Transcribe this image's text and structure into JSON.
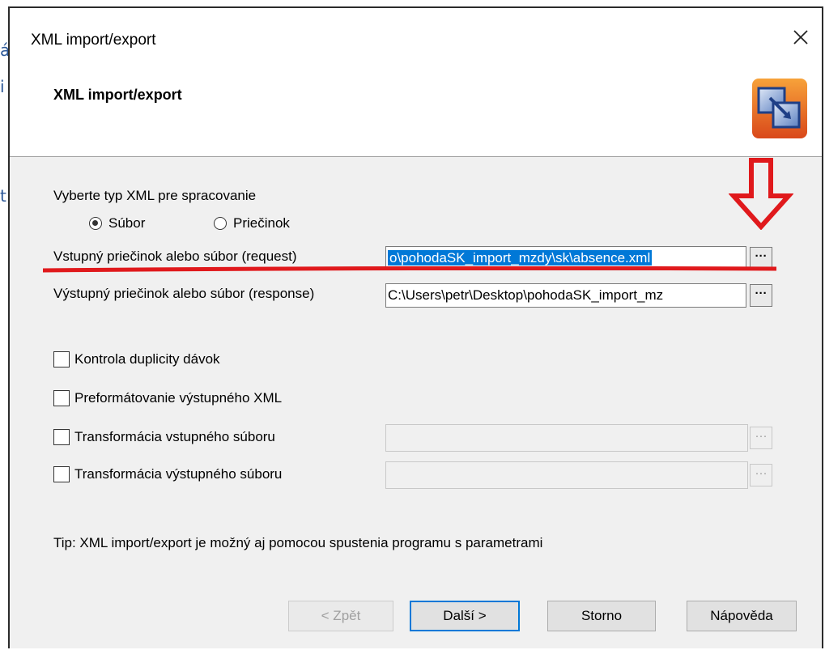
{
  "window": {
    "title": "XML import/export",
    "header_title": "XML import/export"
  },
  "form": {
    "type_prompt": "Vyberte typ XML pre spracovanie",
    "radio_file": "Súbor",
    "radio_folder": "Priečinok",
    "input_label": "Vstupný priečinok alebo súbor (request)",
    "input_value": "o\\pohodaSK_import_mzdy\\sk\\absence.xml",
    "output_label": "Výstupný priečinok alebo súbor (response)",
    "output_value": "C:\\Users\\petr\\Desktop\\pohodaSK_import_mz",
    "browse_label": "···",
    "checkboxes": [
      {
        "label": "Kontrola duplicity dávok"
      },
      {
        "label": "Preformátovanie výstupného XML"
      },
      {
        "label": "Transformácia vstupného súboru"
      },
      {
        "label": "Transformácia výstupného súboru"
      }
    ],
    "tip": "Tip: XML import/export je možný aj pomocou spustenia programu s parametrami"
  },
  "buttons": {
    "back": "< Zpět",
    "next": "Další >",
    "cancel": "Storno",
    "help": "Nápověda"
  },
  "colors": {
    "annotation": "#e0191c",
    "selection": "#0078d7"
  },
  "icons": {
    "close": "close-icon",
    "logo": "app-logo-icon",
    "arrow": "down-arrow-annotation"
  }
}
